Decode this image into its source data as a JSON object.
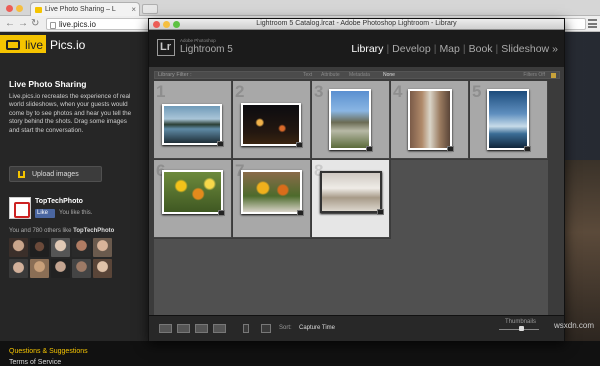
{
  "browser": {
    "tab_title": "Live Photo Sharing – L",
    "tab_close": "×",
    "url": "live.pics.io",
    "back_glyph": "←",
    "forward_glyph": "→",
    "reload_glyph": "↻",
    "menu_icon": "hamburger-icon",
    "traffic_light_colors": [
      "#ec5e57",
      "#f5bf40",
      "#5ec142"
    ]
  },
  "sidebar": {
    "logo_text": "live",
    "brand": "Pics.io",
    "title": "Live Photo Sharing",
    "description": "Live.pics.io recreates the experience of real world slideshows, when your guests would come by to see photos and hear you tell the story behind the shots. Drag some images and start the conversation.",
    "upload_label": "Upload images",
    "profile_name": "TopTechPhoto",
    "like_label": "Like",
    "likes_text": "You like this.",
    "friends_prefix": "You and 780 others like",
    "friends_page": "TopTechPhoto",
    "link_questions": "Questions & Suggestions",
    "link_terms": "Terms of Service",
    "accent_color": "#f5c400"
  },
  "lightroom": {
    "window_title": "Lightroom 5 Catalog.lrcat - Adobe Photoshop Lightroom - Library",
    "logo": "Lr",
    "product_sub": "Adobe Photoshop",
    "product_name": "Lightroom 5",
    "modules": [
      {
        "label": "Library",
        "active": true
      },
      {
        "label": "Develop",
        "active": false
      },
      {
        "label": "Map",
        "active": false
      },
      {
        "label": "Book",
        "active": false
      },
      {
        "label": "Slideshow",
        "active": false
      }
    ],
    "modules_more": "»",
    "filter_label": "Library Filter :",
    "filter_options": [
      "Text",
      "Attribute",
      "Metadata",
      "None"
    ],
    "filter_selected": "None",
    "filters_off": "Filters Off",
    "grid_numbers": [
      "1",
      "2",
      "3",
      "4",
      "5",
      "6",
      "7",
      "8"
    ],
    "sort_label": "Sort:",
    "sort_value": "Capture Time",
    "thumbnails_label": "Thumbnails"
  },
  "watermark": "wsxdn.com"
}
